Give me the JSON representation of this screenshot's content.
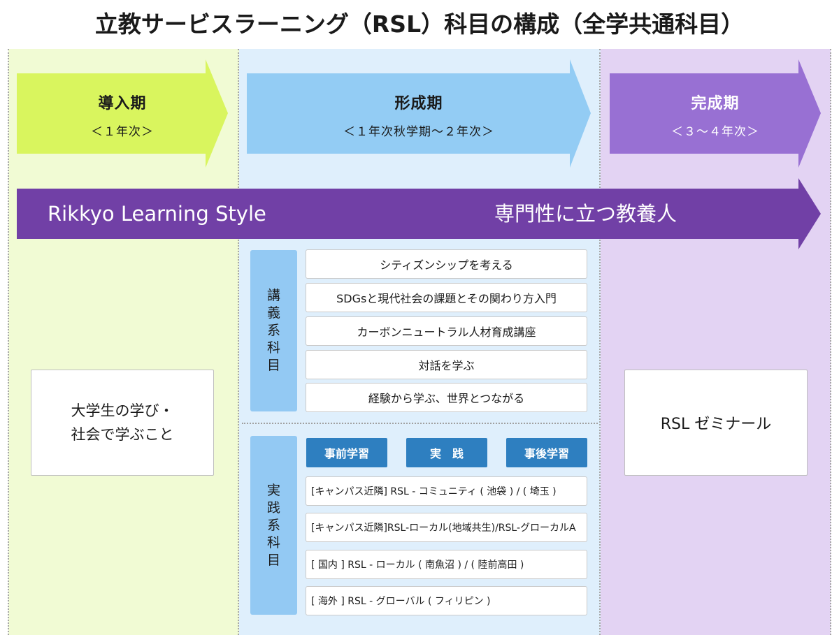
{
  "title": "立教サービスラーニング（RSL）科目の構成（全学共通科目）",
  "phases": [
    {
      "name": "導入期",
      "range": "＜１年次＞",
      "color": "#d9f55e"
    },
    {
      "name": "形成期",
      "range": "＜１年次秋学期〜２年次＞",
      "color": "#93ccf4"
    },
    {
      "name": "完成期",
      "range": "＜３〜４年次＞",
      "color": "#9870d3"
    }
  ],
  "band": {
    "left_text": "Rikkyo Learning Style",
    "right_text": "専門性に立つ教養人",
    "color": "#7140a6"
  },
  "intro_card": {
    "line1": "大学生の学び・",
    "line2": "社会で学ぶこと"
  },
  "seminar_card": {
    "text": "RSL ゼミナール"
  },
  "lecture": {
    "label": "講義系科目",
    "courses": [
      "シティズンシップを考える",
      "SDGsと現代社会の課題とその関わり方入門",
      "カーボンニュートラル人材育成講座",
      "対話を学ぶ",
      "経験から学ぶ、世界とつながる"
    ]
  },
  "practice": {
    "label": "実践系科目",
    "steps": [
      "事前学習",
      "実　践",
      "事後学習"
    ],
    "courses": [
      "[キャンパス近隣] RSL - コミュニティ ( 池袋 ) / ( 埼玉 )",
      "[キャンパス近隣]RSL-ローカル(地域共生)/RSL-グローカルA",
      "[ 国内 ] RSL - ローカル ( 南魚沼 ) / ( 陸前高田 )",
      "[ 海外 ] RSL - グローバル ( フィリピン )"
    ]
  }
}
